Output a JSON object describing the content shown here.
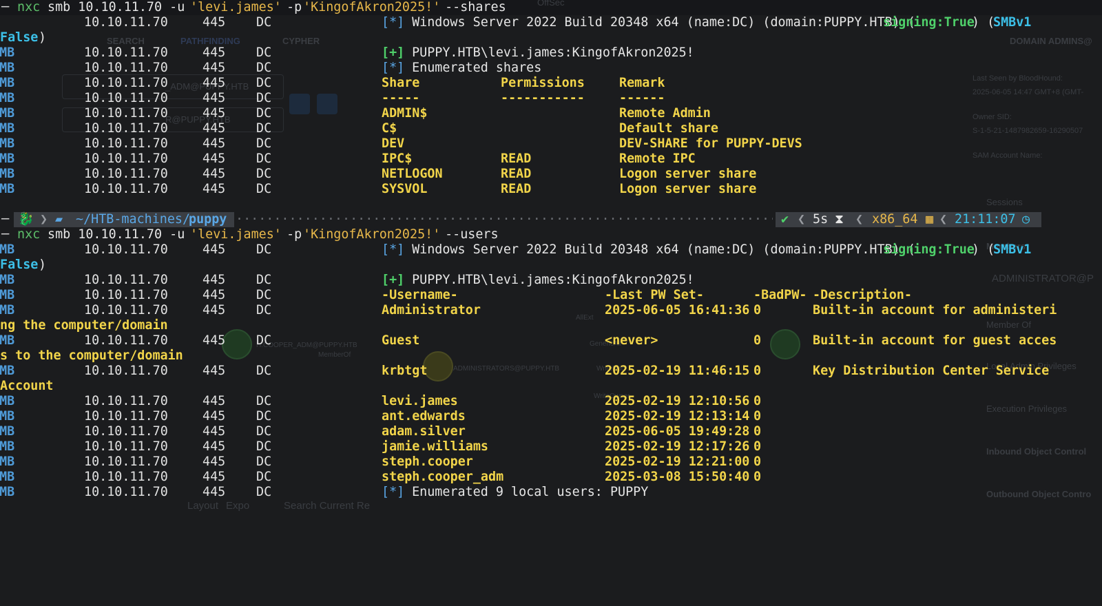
{
  "background_app": {
    "tabs": [
      "SEARCH",
      "PATHFINDING",
      "CYPHER"
    ],
    "right_panel_title": "DOMAIN ADMINS@",
    "last_seen_label": "Last Seen by BloodHound:",
    "last_seen_value": "2025-06-05 14:47 GMT+8 (GMT-",
    "owner_sid_label": "Owner SID:",
    "owner_sid_value": "S-1-5-21-1487982659-16290507",
    "sam_label": "SAM Account Name:",
    "sessions": "Sessions",
    "members": "Members",
    "member_admin": "ADMINISTRATOR@P",
    "member_of": "Member Of",
    "local_admin": "Local Admin Privileges",
    "execution": "Execution Privileges",
    "inbound": "Inbound Object Control",
    "outbound": "Outbound Object Contro",
    "node_adm": "_ADM@PUPPY.HTB",
    "node_r": "R@PUPPY.HTB",
    "edge_cooper": "H.COOPER_ADM@PUPPY.HTB",
    "edge_memberof": "MemberOf",
    "edge_admins": "ADMINISTRATORS@PUPPY.HTB",
    "edge_allext": "AllExt",
    "edge_generic": "GenericAll",
    "edge_writedacl": "WriteDacl",
    "edge_writeowner": "WriteOwner",
    "bottom_layout": "Layout",
    "bottom_export": "Expo",
    "bottom_search": "Search Current Re",
    "offsec": "OffSec"
  },
  "cmd1": {
    "tool": "nxc",
    "args": "smb 10.10.11.70 -u ",
    "user": "'levi.james'",
    "pflag": " -p ",
    "pass": "'KingofAkron2025!'",
    "opt": " --shares"
  },
  "cmd2": {
    "tool": "nxc",
    "args": "smb 10.10.11.70 -u ",
    "user": "'levi.james'",
    "pflag": " -p ",
    "pass": "'KingofAkron2025!'",
    "opt": " --users"
  },
  "common": {
    "proto": "SMB",
    "ip": "10.10.11.70",
    "port": "445",
    "host": "DC"
  },
  "info": {
    "marker_star": "[*]",
    "marker_plus": "[+]",
    "os_text": " Windows Server 2022 Build 20348 x64 (name:DC) (domain:PUPPY.HTB) (",
    "signing": "signing:True",
    "paren_close": ") (",
    "smbv1": "SMBv1",
    "wrap_false": "False",
    "wrap_paren": ")",
    "auth": " PUPPY.HTB\\levi.james:KingofAkron2025!",
    "enum_shares": " Enumerated shares",
    "enum_users": " Enumerated 9 local users: PUPPY"
  },
  "shares": {
    "headers": [
      "Share",
      "Permissions",
      "Remark"
    ],
    "seps": [
      "-----",
      "-----------",
      "------"
    ],
    "rows": [
      [
        "ADMIN$",
        "",
        "Remote Admin"
      ],
      [
        "C$",
        "",
        "Default share"
      ],
      [
        "DEV",
        "",
        "DEV-SHARE for PUPPY-DEVS"
      ],
      [
        "IPC$",
        "READ",
        "Remote IPC"
      ],
      [
        "NETLOGON",
        "READ",
        "Logon server share"
      ],
      [
        "SYSVOL",
        "READ",
        "Logon server share"
      ]
    ]
  },
  "prompt": {
    "path_prefix": "~/HTB-machines/",
    "path_dir": "puppy",
    "check": "✔",
    "duration": "5s",
    "hourglass": "⧗",
    "arch": "x86_64",
    "time": "21:11:07"
  },
  "users": {
    "headers": [
      "-Username-",
      "-Last PW Set-",
      "-BadPW-",
      "-Description-"
    ],
    "rows": [
      {
        "name": "Administrator",
        "pw": "2025-06-05 16:41:36",
        "bad": "0",
        "desc": "Built-in account for administeri",
        "wrap": "ng the computer/domain"
      },
      {
        "name": "Guest",
        "pw": "<never>",
        "bad": "0",
        "desc": "Built-in account for guest acces",
        "wrap": "s to the computer/domain"
      },
      {
        "name": "krbtgt",
        "pw": "2025-02-19 11:46:15",
        "bad": "0",
        "desc": "Key Distribution Center Service",
        "wrap": "Account"
      },
      {
        "name": "levi.james",
        "pw": "2025-02-19 12:10:56",
        "bad": "0",
        "desc": "",
        "wrap": ""
      },
      {
        "name": "ant.edwards",
        "pw": "2025-02-19 12:13:14",
        "bad": "0",
        "desc": "",
        "wrap": ""
      },
      {
        "name": "adam.silver",
        "pw": "2025-06-05 19:49:28",
        "bad": "0",
        "desc": "",
        "wrap": ""
      },
      {
        "name": "jamie.williams",
        "pw": "2025-02-19 12:17:26",
        "bad": "0",
        "desc": "",
        "wrap": ""
      },
      {
        "name": "steph.cooper",
        "pw": "2025-02-19 12:21:00",
        "bad": "0",
        "desc": "",
        "wrap": ""
      },
      {
        "name": "steph.cooper_adm",
        "pw": "2025-03-08 15:50:40",
        "bad": "0",
        "desc": "",
        "wrap": ""
      }
    ]
  }
}
